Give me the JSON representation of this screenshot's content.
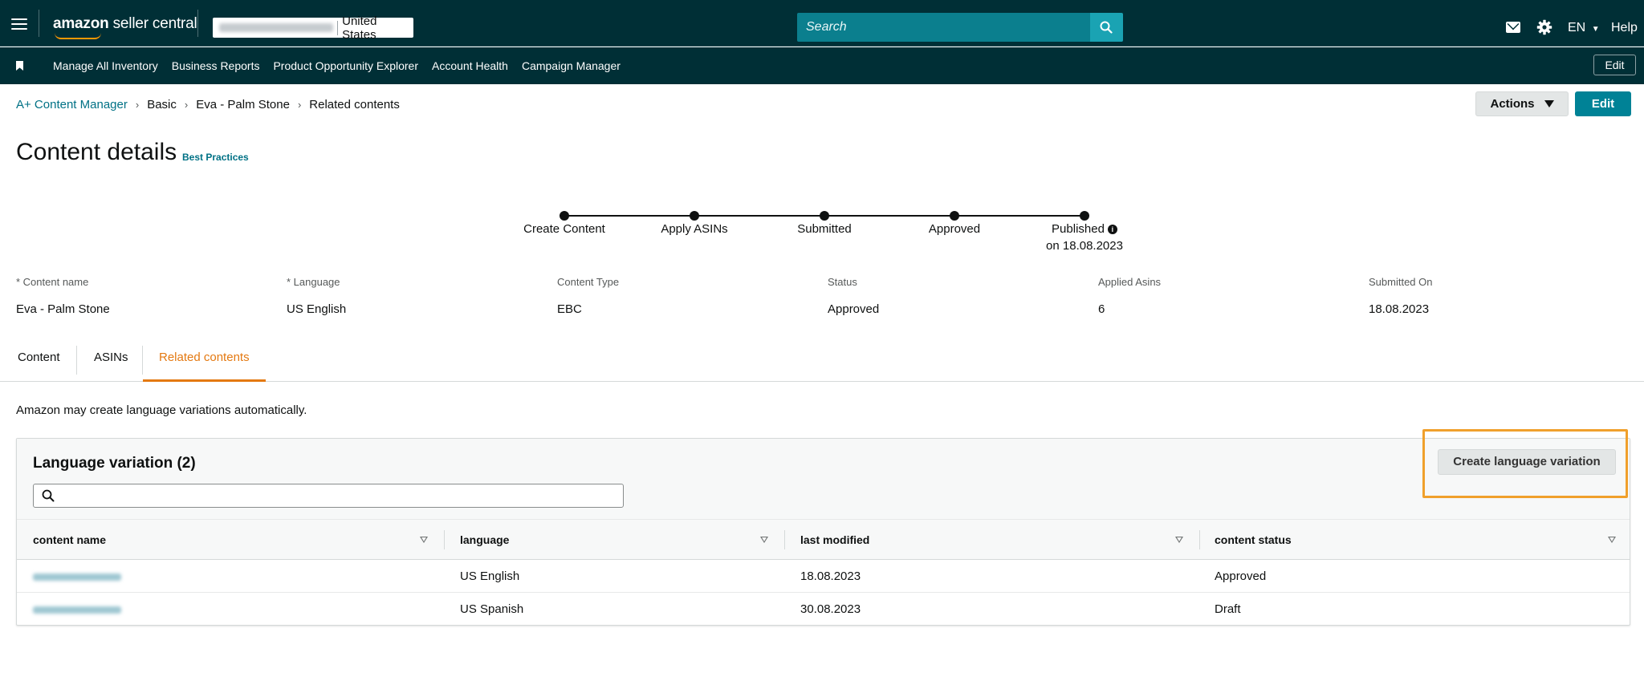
{
  "topbar": {
    "logo_bold": "amazon",
    "logo_rest": " seller central",
    "store_region": "United States",
    "search_placeholder": "Search",
    "language": "EN",
    "help": "Help"
  },
  "shortcuts": {
    "items": [
      "Manage All Inventory",
      "Business Reports",
      "Product Opportunity Explorer",
      "Account Health",
      "Campaign Manager"
    ],
    "edit_label": "Edit"
  },
  "breadcrumb": [
    "A+ Content Manager",
    "Basic",
    "Eva - Palm Stone",
    "Related contents"
  ],
  "actions_label": "Actions",
  "edit_label": "Edit",
  "title": "Content details",
  "best_practices": "Best Practices",
  "steps": [
    {
      "label": "Create Content"
    },
    {
      "label": "Apply ASINs"
    },
    {
      "label": "Submitted"
    },
    {
      "label": "Approved"
    },
    {
      "label": "Published",
      "sub": "on 18.08.2023"
    }
  ],
  "details": [
    {
      "label": "* Content name",
      "value": "Eva - Palm Stone"
    },
    {
      "label": "* Language",
      "value": "US English"
    },
    {
      "label": "Content Type",
      "value": "EBC"
    },
    {
      "label": "Status",
      "value": "Approved"
    },
    {
      "label": "Applied Asins",
      "value": "6"
    },
    {
      "label": "Submitted On",
      "value": "18.08.2023"
    }
  ],
  "tabs": [
    {
      "label": "Content",
      "active": false
    },
    {
      "label": "ASINs",
      "active": false
    },
    {
      "label": "Related contents",
      "active": true
    }
  ],
  "note": "Amazon may create language variations automatically.",
  "variations": {
    "title": "Language variation (2)",
    "search_value": "",
    "create_label": "Create language variation",
    "columns": [
      "content name",
      "language",
      "last modified",
      "content status"
    ],
    "rows": [
      {
        "language": "US English",
        "last_modified": "18.08.2023",
        "status": "Approved"
      },
      {
        "language": "US Spanish",
        "last_modified": "30.08.2023",
        "status": "Draft"
      }
    ]
  },
  "colors": {
    "nav_bg": "#002f36",
    "link": "#007185",
    "accent_tab": "#e47911",
    "primary_button": "#008296",
    "highlight_frame": "#f0a02c"
  }
}
